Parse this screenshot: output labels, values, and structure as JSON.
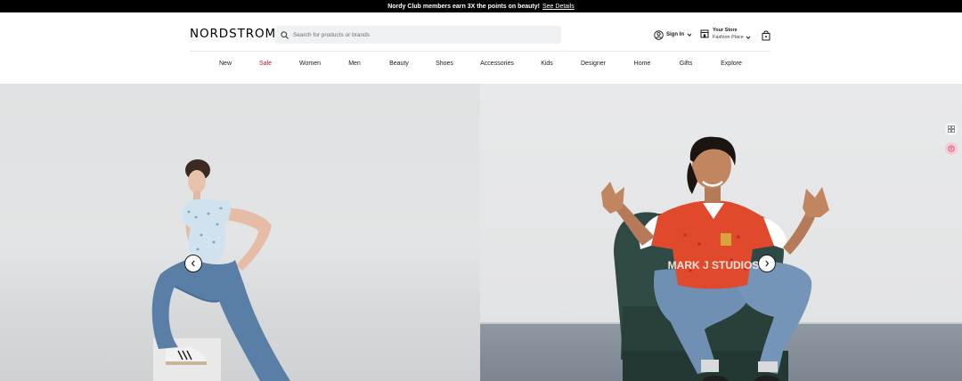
{
  "promo": {
    "text": "Nordy Club members earn 3X the points on beauty!",
    "link": "See Details"
  },
  "header": {
    "logo": "NORDSTROM",
    "search_placeholder": "Search for products or brands",
    "signin_label": "Sign In",
    "store_title": "Your Store",
    "store_name": "Fashion Place",
    "icons": [
      "search-icon",
      "user-icon",
      "store-icon",
      "chevron-down-icon",
      "shopping-bag-icon"
    ]
  },
  "nav": {
    "items": [
      "New",
      "Sale",
      "Women",
      "Men",
      "Beauty",
      "Shoes",
      "Accessories",
      "Kids",
      "Designer",
      "Home",
      "Gifts",
      "Explore"
    ],
    "sale_color": "#c8102e"
  },
  "hero": {
    "prev_icon": "chevron-left-icon",
    "next_icon": "chevron-right-icon",
    "left_image": "woman in floral top and jeans posing",
    "right_image": "man in red football shirt seated in green armchair",
    "right_shirt_text": "MARK J STUDIOS"
  },
  "side_tools": [
    "grid-icon",
    "translate-icon"
  ],
  "colors": {
    "promo_bg": "#000000",
    "search_bg": "#f0f1f3",
    "accent": "#c8102e"
  }
}
